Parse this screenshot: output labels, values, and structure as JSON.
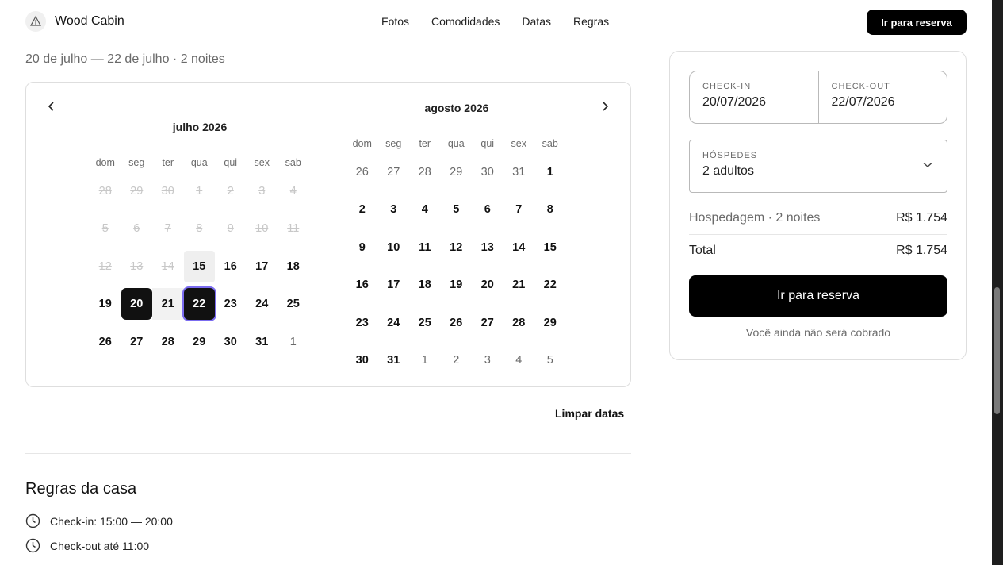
{
  "header": {
    "brand": "Wood Cabin",
    "logo_icon": "cabin-logo-icon",
    "nav": [
      "Fotos",
      "Comodidades",
      "Datas",
      "Regras"
    ],
    "cta": "Ir para reserva"
  },
  "dates_summary": "20 de julho — 22 de julho · 2 noites",
  "calendar": {
    "weekdays": [
      "dom",
      "seg",
      "ter",
      "qua",
      "qui",
      "sex",
      "sab"
    ],
    "months": [
      {
        "title": "julho 2026",
        "weeks": [
          [
            {
              "d": "28",
              "s": "past"
            },
            {
              "d": "29",
              "s": "past"
            },
            {
              "d": "30",
              "s": "past"
            },
            {
              "d": "1",
              "s": "past"
            },
            {
              "d": "2",
              "s": "past"
            },
            {
              "d": "3",
              "s": "past"
            },
            {
              "d": "4",
              "s": "past"
            }
          ],
          [
            {
              "d": "5",
              "s": "past"
            },
            {
              "d": "6",
              "s": "past"
            },
            {
              "d": "7",
              "s": "past"
            },
            {
              "d": "8",
              "s": "past"
            },
            {
              "d": "9",
              "s": "past"
            },
            {
              "d": "10",
              "s": "past"
            },
            {
              "d": "11",
              "s": "past"
            }
          ],
          [
            {
              "d": "12",
              "s": "past"
            },
            {
              "d": "13",
              "s": "past"
            },
            {
              "d": "14",
              "s": "past"
            },
            {
              "d": "15",
              "s": "hover"
            },
            {
              "d": "16",
              "s": ""
            },
            {
              "d": "17",
              "s": ""
            },
            {
              "d": "18",
              "s": ""
            }
          ],
          [
            {
              "d": "19",
              "s": ""
            },
            {
              "d": "20",
              "s": "sel"
            },
            {
              "d": "21",
              "s": "range"
            },
            {
              "d": "22",
              "s": "sel-end"
            },
            {
              "d": "23",
              "s": ""
            },
            {
              "d": "24",
              "s": ""
            },
            {
              "d": "25",
              "s": ""
            }
          ],
          [
            {
              "d": "26",
              "s": ""
            },
            {
              "d": "27",
              "s": ""
            },
            {
              "d": "28",
              "s": ""
            },
            {
              "d": "29",
              "s": ""
            },
            {
              "d": "30",
              "s": ""
            },
            {
              "d": "31",
              "s": ""
            },
            {
              "d": "1",
              "s": "out"
            }
          ]
        ]
      },
      {
        "title": "agosto 2026",
        "weeks": [
          [
            {
              "d": "26",
              "s": "out"
            },
            {
              "d": "27",
              "s": "out"
            },
            {
              "d": "28",
              "s": "out"
            },
            {
              "d": "29",
              "s": "out"
            },
            {
              "d": "30",
              "s": "out"
            },
            {
              "d": "31",
              "s": "out"
            },
            {
              "d": "1",
              "s": ""
            }
          ],
          [
            {
              "d": "2",
              "s": ""
            },
            {
              "d": "3",
              "s": ""
            },
            {
              "d": "4",
              "s": ""
            },
            {
              "d": "5",
              "s": ""
            },
            {
              "d": "6",
              "s": ""
            },
            {
              "d": "7",
              "s": ""
            },
            {
              "d": "8",
              "s": ""
            }
          ],
          [
            {
              "d": "9",
              "s": ""
            },
            {
              "d": "10",
              "s": ""
            },
            {
              "d": "11",
              "s": ""
            },
            {
              "d": "12",
              "s": ""
            },
            {
              "d": "13",
              "s": ""
            },
            {
              "d": "14",
              "s": ""
            },
            {
              "d": "15",
              "s": ""
            }
          ],
          [
            {
              "d": "16",
              "s": ""
            },
            {
              "d": "17",
              "s": ""
            },
            {
              "d": "18",
              "s": ""
            },
            {
              "d": "19",
              "s": ""
            },
            {
              "d": "20",
              "s": ""
            },
            {
              "d": "21",
              "s": ""
            },
            {
              "d": "22",
              "s": ""
            }
          ],
          [
            {
              "d": "23",
              "s": ""
            },
            {
              "d": "24",
              "s": ""
            },
            {
              "d": "25",
              "s": ""
            },
            {
              "d": "26",
              "s": ""
            },
            {
              "d": "27",
              "s": ""
            },
            {
              "d": "28",
              "s": ""
            },
            {
              "d": "29",
              "s": ""
            }
          ],
          [
            {
              "d": "30",
              "s": ""
            },
            {
              "d": "31",
              "s": ""
            },
            {
              "d": "1",
              "s": "out"
            },
            {
              "d": "2",
              "s": "out"
            },
            {
              "d": "3",
              "s": "out"
            },
            {
              "d": "4",
              "s": "out"
            },
            {
              "d": "5",
              "s": "out"
            }
          ]
        ]
      }
    ],
    "prev_icon": "chevron-left-icon",
    "next_icon": "chevron-right-icon",
    "clear_label": "Limpar datas"
  },
  "rules": {
    "title": "Regras da casa",
    "items": [
      "Check-in: 15:00 — 20:00",
      "Check-out até 11:00"
    ]
  },
  "booking": {
    "checkin_label": "CHECK-IN",
    "checkin_value": "20/07/2026",
    "checkout_label": "CHECK-OUT",
    "checkout_value": "22/07/2026",
    "guests_label": "HÓSPEDES",
    "guests_value": "2 adultos",
    "stay_label": "Hospedagem · 2 noites",
    "stay_price": "R$ 1.754",
    "total_label": "Total",
    "total_price": "R$ 1.754",
    "button": "Ir para reserva",
    "note": "Você ainda não será cobrado"
  },
  "colors": {
    "primary": "#000000",
    "selection_ring": "#7b6cf0"
  }
}
